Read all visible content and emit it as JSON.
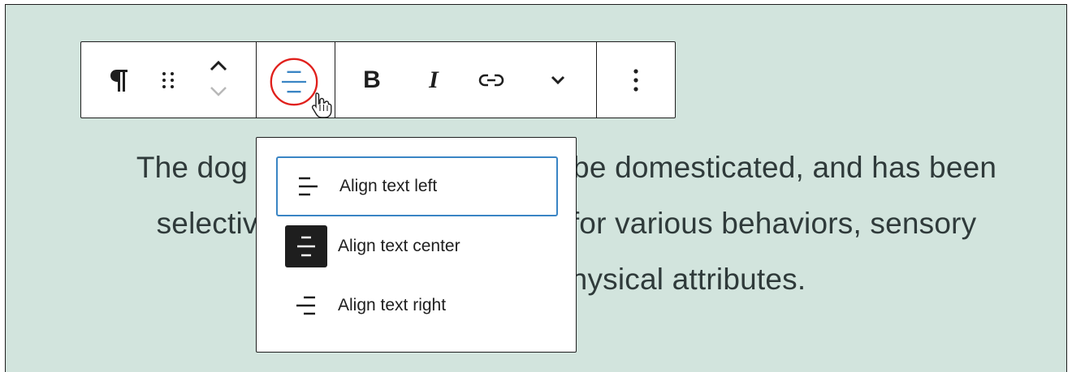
{
  "toolbar": {
    "block_type_icon": "paragraph-icon",
    "drag_icon": "drag-handle-icon",
    "move_icon": "move-up-down-icon",
    "align_icon": "align-center-icon",
    "bold_label": "B",
    "italic_label": "I",
    "link_icon": "link-icon",
    "more_icon": "chevron-down-icon",
    "options_icon": "vertical-ellipsis-icon",
    "highlight_color": "#e0201c",
    "accent_color": "#3a85c4"
  },
  "paragraph": {
    "lines": [
      "The dog was the first species to be domesticated, and has been",
      "selectively bred over millennia for various behaviors, sensory",
      "capabilities, and physical attributes."
    ]
  },
  "dropdown": {
    "items": [
      {
        "label": "Align text left",
        "icon": "align-left-icon"
      },
      {
        "label": "Align text center",
        "icon": "align-center-icon"
      },
      {
        "label": "Align text right",
        "icon": "align-right-icon"
      }
    ]
  }
}
